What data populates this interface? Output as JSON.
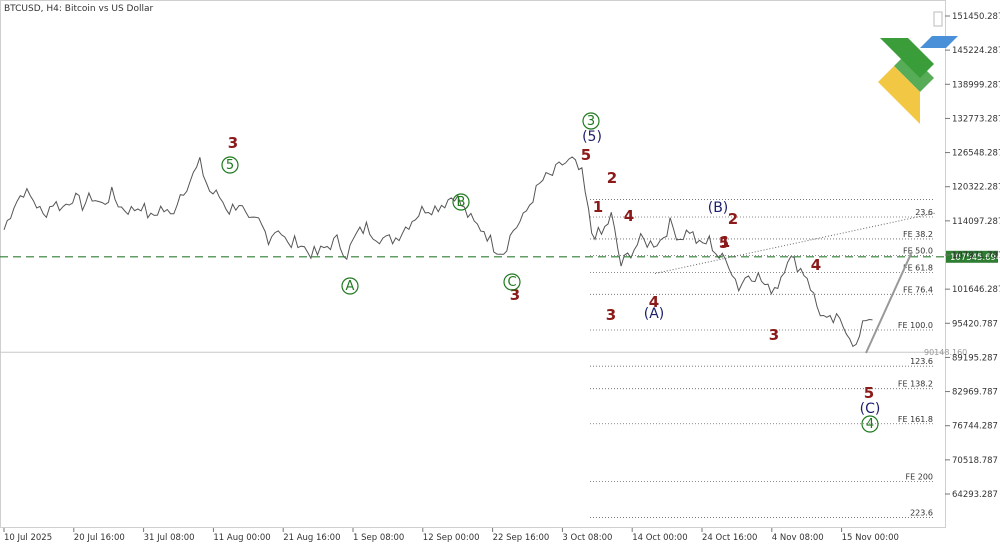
{
  "header": {
    "title": "BTCUSD, H4:  Bitcoin vs US Dollar"
  },
  "colors": {
    "price": "#555555",
    "wave_red": "#8b1a1a",
    "wave_green": "#1f7a1f",
    "wave_blue": "#1e1e6e",
    "support_line": "#2e7d32",
    "badge_bg": "#2e7d32",
    "logo_green": "#3a9d3a",
    "logo_yellow": "#f2c744",
    "logo_blue": "#4a90d9"
  },
  "icons": [
    "scroll-handle-icon",
    "brand-logo-icon"
  ],
  "chart_data": {
    "type": "line",
    "title": "BTCUSD, H4:  Bitcoin vs US Dollar",
    "x_labels": [
      "10 Jul 2025",
      "20 Jul 16:00",
      "31 Jul 08:00",
      "11 Aug 00:00",
      "21 Aug 16:00",
      "1 Sep 08:00",
      "12 Sep 00:00",
      "22 Sep 16:00",
      "3 Oct 08:00",
      "14 Oct 00:00",
      "24 Oct 16:00",
      "4 Nov 08:00",
      "15 Nov 00:00"
    ],
    "y_ticks": [
      "151450.287",
      "145224.287",
      "138999.287",
      "132773.287",
      "126548.287",
      "120322.287",
      "114097.287",
      "107871.787",
      "101646.287",
      "95420.787",
      "89195.287",
      "82969.787",
      "76744.287",
      "70518.787",
      "64293.287"
    ],
    "ylim": [
      64293.287,
      151450.287
    ],
    "series": [
      {
        "values": [
          112500,
          117000,
          119500,
          118000,
          115000,
          117500,
          116500,
          118500,
          117000,
          118500,
          117000,
          119000,
          116500,
          116000,
          117000,
          114500,
          116500,
          115000,
          119000,
          121500,
          124500,
          119500,
          118500,
          116000,
          117500,
          113500,
          114000,
          111000,
          113000,
          109500,
          110500,
          108500,
          108000,
          109500,
          110500,
          108000,
          111500,
          113000,
          111500,
          110500,
          111000,
          113000,
          115000,
          116500,
          116500,
          117500,
          119000,
          116000,
          113500,
          112500,
          109500,
          108500,
          112500,
          114500,
          118500,
          121500,
          122500,
          124500,
          125000,
          122500,
          112000,
          111500,
          115000,
          106000,
          108500,
          110500,
          110000,
          110500,
          113500,
          111000,
          112500,
          109500,
          110500,
          107500,
          106500,
          102000,
          104500,
          104000,
          101500,
          102500,
          107500,
          106000,
          104000,
          98500,
          95500,
          96000,
          94500,
          91000,
          96500
        ]
      }
    ],
    "current_price": "107545.694",
    "lower_marker": "90148.160",
    "fib_levels": [
      "23.6",
      "FE 38.2",
      "FE 50.0",
      "FE 61.8",
      "FE 76.4",
      "FE 100.0",
      "123.6",
      "FE 138.2",
      "FE 161.8",
      "FE 200",
      "223.6"
    ],
    "wave_labels": {
      "red": [
        "3",
        "3",
        "4",
        "5",
        "2",
        "1",
        "4",
        "5",
        "3",
        "2",
        "1",
        "3",
        "4",
        "5"
      ],
      "green_circled": [
        "5",
        "A",
        "B",
        "C",
        "3",
        "4"
      ],
      "blue": [
        "(5)",
        "(A)",
        "(B)",
        "(C)"
      ]
    }
  }
}
